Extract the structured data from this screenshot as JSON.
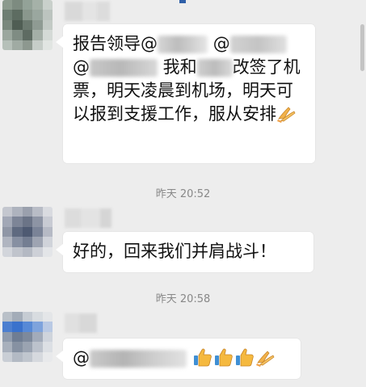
{
  "colors": {
    "background": "#ededed",
    "bubble": "#ffffff",
    "text": "#111111",
    "timestamp": "#888888"
  },
  "messages": [
    {
      "sender": "redacted",
      "at_symbol_1": "@",
      "at_symbol_2": "@",
      "text_head": "报告领导",
      "text_mid_prefix": " 我和",
      "text_tail": "改签了机票，明天凌晨到机场，明天可以报到支援工作，服从安排",
      "emoji": "hands-together-icon"
    },
    {
      "sender": "redacted",
      "text": "好的，回来我们并肩战斗！"
    },
    {
      "sender": "redacted",
      "at_symbol": "@",
      "emojis": [
        "thumbs-up-icon",
        "thumbs-up-icon",
        "thumbs-up-icon",
        "hands-together-icon"
      ]
    }
  ],
  "timestamps": [
    "昨天 20:52",
    "昨天 20:58"
  ]
}
